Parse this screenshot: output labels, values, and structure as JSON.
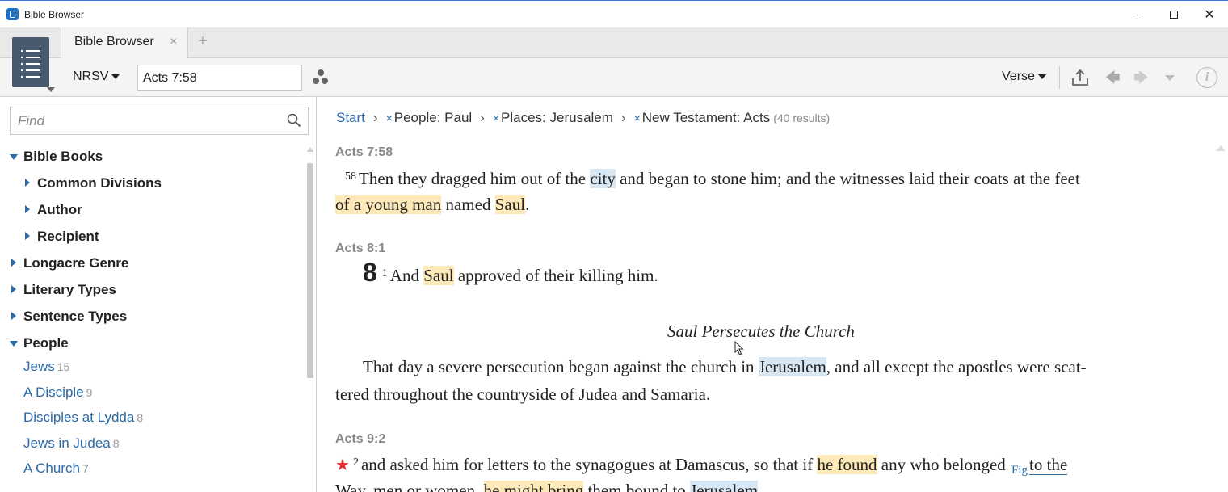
{
  "window": {
    "title": "Bible Browser",
    "minimize_icon": "minimize-icon",
    "maximize_icon": "maximize-icon",
    "close_glyph": "✕"
  },
  "tabs": [
    {
      "label": "Bible Browser",
      "close": "×"
    }
  ],
  "tab_add": "+",
  "toolbar": {
    "version": "NRSV",
    "reference": "Acts 7:58",
    "view_mode": "Verse"
  },
  "sidebar": {
    "find_placeholder": "Find",
    "tree": [
      {
        "label": "Bible Books",
        "level": 0,
        "expanded": true
      },
      {
        "label": "Common Divisions",
        "level": 1,
        "expanded": false
      },
      {
        "label": "Author",
        "level": 1,
        "expanded": false
      },
      {
        "label": "Recipient",
        "level": 1,
        "expanded": false
      },
      {
        "label": "Longacre Genre",
        "level": 0,
        "expanded": false
      },
      {
        "label": "Literary Types",
        "level": 0,
        "expanded": false
      },
      {
        "label": "Sentence Types",
        "level": 0,
        "expanded": false
      },
      {
        "label": "People",
        "level": 0,
        "expanded": true
      }
    ],
    "people": [
      {
        "label": "Jews",
        "count": "15"
      },
      {
        "label": "A Disciple",
        "count": "9"
      },
      {
        "label": "Disciples at Lydda",
        "count": "8"
      },
      {
        "label": "Jews in Judea",
        "count": "8"
      },
      {
        "label": "A Church",
        "count": "7"
      }
    ]
  },
  "breadcrumb": {
    "start": "Start",
    "separator": "›",
    "remove": "×",
    "filters": [
      "People: Paul",
      "Places: Jerusalem",
      "New Testament: Acts"
    ],
    "results": "(40 results)"
  },
  "passages": [
    {
      "ref": "Acts 7:58",
      "verse_num": "58",
      "line1_a": "Then they dragged him out of the ",
      "line1_city": "city",
      "line1_b": " and began to stone him; and the witnesses laid their coats at the feet",
      "line2_young": "of a young man",
      "line2_b": " named ",
      "line2_saul": "Saul",
      "line2_end": "."
    },
    {
      "ref": "Acts 8:1",
      "chapter": "8",
      "verse_num": "1",
      "line1_a": "And ",
      "line1_saul": "Saul",
      "line1_b": " approved of their killing him.",
      "heading": "Saul Persecutes the Church",
      "para_a": "That day a severe persecution began against the church in ",
      "para_jerusalem": "Jerusalem",
      "para_b": ", and all except the apostles were scat-",
      "para_line2": "tered throughout the countryside of Judea and Samaria."
    },
    {
      "ref": "Acts 9:2",
      "star": "★",
      "verse_num": "2",
      "line1_a": "and asked him for letters to the synagogues at Damascus, so that if ",
      "line1_found": "he found",
      "line1_b": " any who belonged ",
      "fig": "Fig",
      "line1_c": "to the",
      "line2_a": "Way, men or women, ",
      "line2_bring": "he might bring",
      "line2_b": " them bound to ",
      "line2_jerusalem": "Jerusalem",
      "line2_end": "."
    }
  ],
  "colors": {
    "accent": "#2a6aa6",
    "highlight_yellow": "#fde9b8",
    "highlight_blue": "#d7e7f4",
    "panel_menu": "#4a5a6e",
    "star": "#e03030"
  }
}
